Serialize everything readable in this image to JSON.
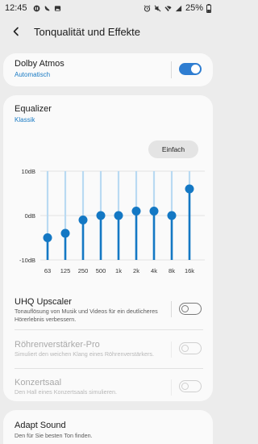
{
  "status_bar": {
    "time": "12:45",
    "battery": "25%"
  },
  "header": {
    "title": "Tonqualität und Effekte"
  },
  "dolby": {
    "title": "Dolby Atmos",
    "subtitle": "Automatisch",
    "enabled": true
  },
  "equalizer": {
    "title": "Equalizer",
    "preset": "Klassik",
    "button_label": "Einfach",
    "y_labels": [
      "10dB",
      "0dB",
      "-10dB"
    ],
    "bands": [
      "63",
      "125",
      "250",
      "500",
      "1k",
      "2k",
      "4k",
      "8k",
      "16k"
    ],
    "values_db": [
      -5,
      -4,
      -1,
      0,
      0,
      1,
      1,
      0,
      6
    ],
    "range_db": [
      -10,
      10
    ]
  },
  "options": [
    {
      "title": "UHQ Upscaler",
      "desc": "Tonauflösung von Musik und Videos für ein deutlicheres Hörerlebnis verbessern.",
      "enabled": false,
      "available": true
    },
    {
      "title": "Röhrenverstärker-Pro",
      "desc": "Simuliert den weichen Klang eines Röhrenverstärkers.",
      "enabled": false,
      "available": false
    },
    {
      "title": "Konzertsaal",
      "desc": "Den Hall eines Konzertsaals simulieren.",
      "enabled": false,
      "available": false
    }
  ],
  "adapt_sound": {
    "title": "Adapt Sound",
    "desc": "Den für Sie besten Ton finden."
  },
  "colors": {
    "accent": "#1a7bc4",
    "bar_light": "#b9daf2",
    "bar_dark": "#1478c4",
    "knob": "#1478c4"
  }
}
